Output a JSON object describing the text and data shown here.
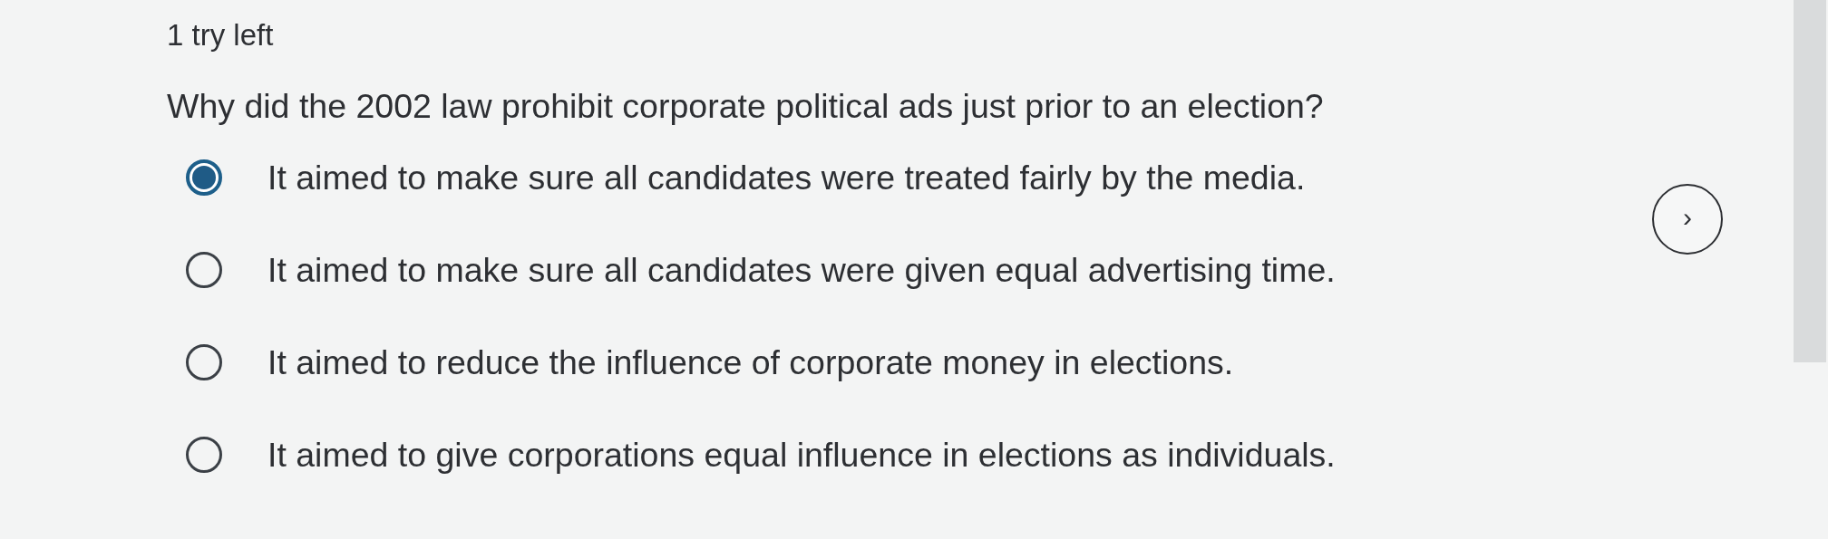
{
  "attempts": "1 try left",
  "question": "Why did the 2002 law prohibit corporate political ads just prior to an election?",
  "options": [
    {
      "label": "It aimed to make sure all candidates were treated fairly by the media.",
      "selected": true
    },
    {
      "label": "It aimed to make sure all candidates were given equal advertising time.",
      "selected": false
    },
    {
      "label": "It aimed to reduce the influence of corporate money in elections.",
      "selected": false
    },
    {
      "label": "It aimed to give corporations equal influence in elections as individuals.",
      "selected": false
    }
  ],
  "next_button": {
    "label": "›"
  }
}
